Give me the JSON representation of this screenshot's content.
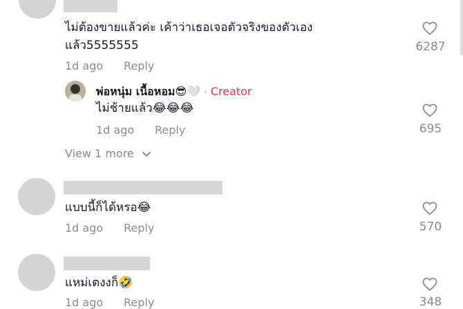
{
  "comments": [
    {
      "text_line1": "ไม่ต้องขายแล้วค่ะ เค้าว่าเธอเจอตัวจริงของตัวเอง",
      "text_line2": "แล้ว5555555",
      "time": "1d ago",
      "reply_label": "Reply",
      "likes": "6287"
    },
    {
      "text": "แบบนี้ก็ได้หรอ😂",
      "time": "1d ago",
      "reply_label": "Reply",
      "likes": "570"
    },
    {
      "text": "แหม่เตงงก็🤣",
      "time": "1d ago",
      "reply_label": "Reply",
      "likes": "348"
    }
  ],
  "reply": {
    "username": "พ่อหนุ่ม เนื้อหอม😎🤍",
    "separator": "·",
    "badge": "Creator",
    "text": "ไม่ช้ายแล้ว😂😂😂",
    "time": "1d ago",
    "reply_label": "Reply",
    "likes": "695"
  },
  "view_more": "View 1 more",
  "icons": {
    "like": "heart-outline-icon",
    "expand": "chevron-down-icon"
  },
  "colors": {
    "creator": "#fe2c55",
    "muted": "#8a8b91",
    "text": "#161823"
  }
}
